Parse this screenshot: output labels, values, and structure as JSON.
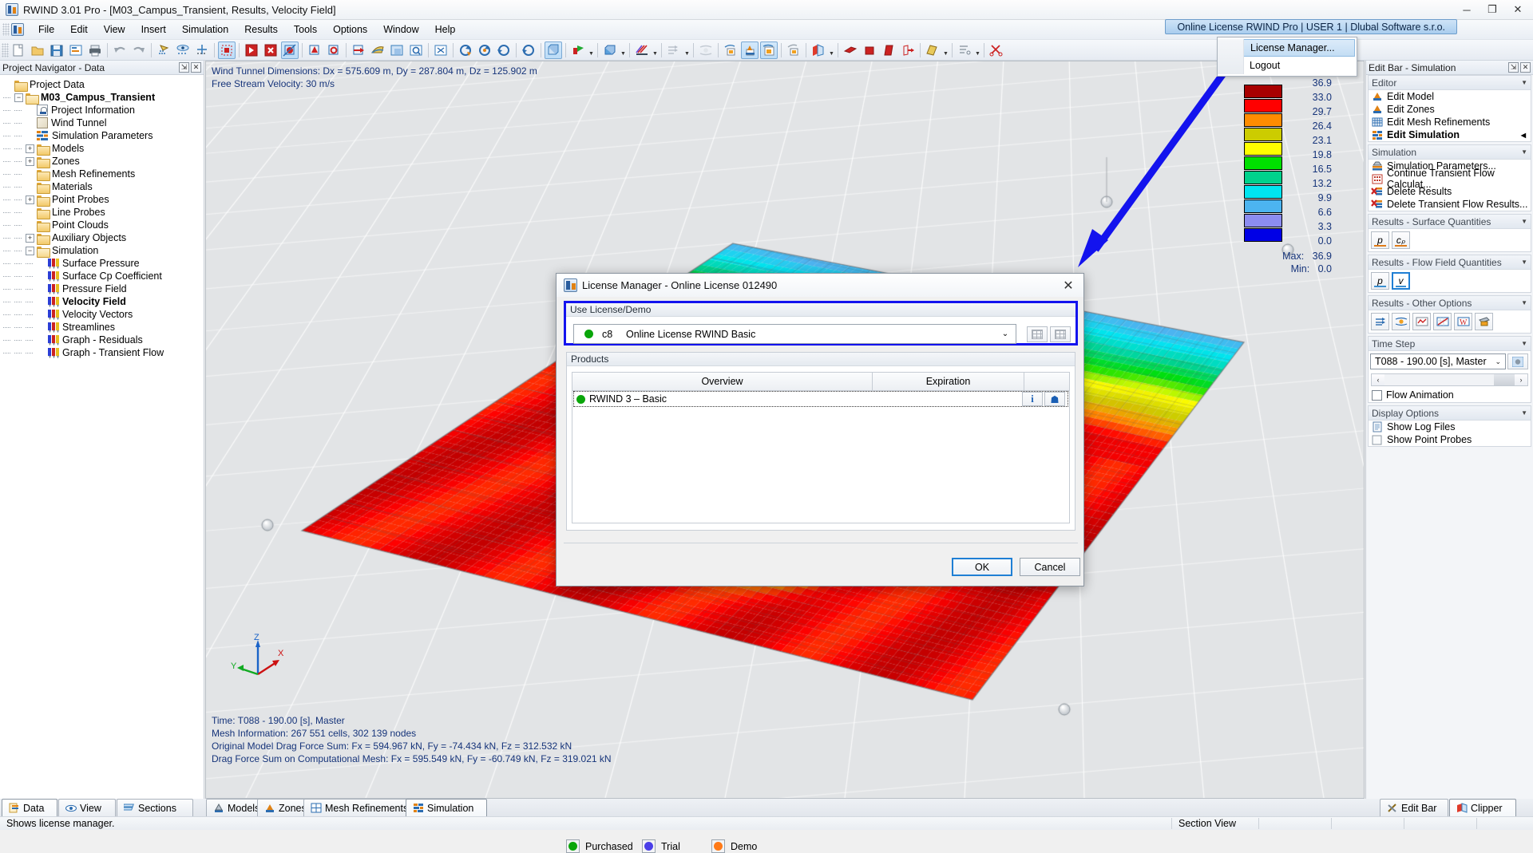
{
  "titlebar": {
    "title": "RWIND 3.01 Pro - [M03_Campus_Transient, Results, Velocity Field]",
    "minimize": "─",
    "restore": "❐",
    "close": "✕"
  },
  "menubar": {
    "items": [
      "File",
      "Edit",
      "View",
      "Insert",
      "Simulation",
      "Results",
      "Tools",
      "Options",
      "Window",
      "Help"
    ]
  },
  "license": {
    "button_label": "Online License RWIND Pro | USER 1 | Dlubal Software s.r.o.",
    "menu": [
      "License Manager...",
      "Logout"
    ]
  },
  "navigator": {
    "title": "Project Navigator - Data",
    "pin": "⇲",
    "close": "✕",
    "tree": [
      {
        "label": "Project Data",
        "depth": 0,
        "icon": "folder",
        "toggle": "none",
        "bold": false
      },
      {
        "label": "M03_Campus_Transient",
        "depth": 1,
        "icon": "folder-open",
        "toggle": "minus",
        "bold": true
      },
      {
        "label": "Project Information",
        "depth": 2,
        "icon": "doc",
        "toggle": "none",
        "bold": false
      },
      {
        "label": "Wind Tunnel",
        "depth": 2,
        "icon": "cube",
        "toggle": "none",
        "bold": false
      },
      {
        "label": "Simulation Parameters",
        "depth": 2,
        "icon": "simparams",
        "toggle": "none",
        "bold": false
      },
      {
        "label": "Models",
        "depth": 2,
        "icon": "folder",
        "toggle": "plus",
        "bold": false
      },
      {
        "label": "Zones",
        "depth": 2,
        "icon": "folder",
        "toggle": "plus",
        "bold": false
      },
      {
        "label": "Mesh Refinements",
        "depth": 2,
        "icon": "folder",
        "toggle": "none",
        "bold": false
      },
      {
        "label": "Materials",
        "depth": 2,
        "icon": "folder",
        "toggle": "none",
        "bold": false
      },
      {
        "label": "Point Probes",
        "depth": 2,
        "icon": "folder",
        "toggle": "plus",
        "bold": false
      },
      {
        "label": "Line Probes",
        "depth": 2,
        "icon": "folder",
        "toggle": "none",
        "bold": false
      },
      {
        "label": "Point Clouds",
        "depth": 2,
        "icon": "folder",
        "toggle": "none",
        "bold": false
      },
      {
        "label": "Auxiliary Objects",
        "depth": 2,
        "icon": "folder",
        "toggle": "plus",
        "bold": false
      },
      {
        "label": "Simulation",
        "depth": 2,
        "icon": "folder-open",
        "toggle": "minus",
        "bold": false
      },
      {
        "label": "Surface Pressure",
        "depth": 3,
        "icon": "bars",
        "toggle": "none",
        "bold": false
      },
      {
        "label": "Surface Cp Coefficient",
        "depth": 3,
        "icon": "bars",
        "toggle": "none",
        "bold": false
      },
      {
        "label": "Pressure Field",
        "depth": 3,
        "icon": "bars",
        "toggle": "none",
        "bold": false
      },
      {
        "label": "Velocity Field",
        "depth": 3,
        "icon": "bars",
        "toggle": "none",
        "bold": true
      },
      {
        "label": "Velocity Vectors",
        "depth": 3,
        "icon": "bars",
        "toggle": "none",
        "bold": false
      },
      {
        "label": "Streamlines",
        "depth": 3,
        "icon": "bars",
        "toggle": "none",
        "bold": false
      },
      {
        "label": "Graph - Residuals",
        "depth": 3,
        "icon": "bars",
        "toggle": "none",
        "bold": false
      },
      {
        "label": "Graph - Transient Flow",
        "depth": 3,
        "icon": "bars",
        "toggle": "none",
        "bold": false
      }
    ]
  },
  "view3d": {
    "top_info_line1": "Wind Tunnel Dimensions: Dx = 575.609 m, Dy = 287.804 m, Dz = 125.902 m",
    "top_info_line2": "Free Stream Velocity: 30 m/s",
    "bottom_info": [
      "Time: T088 - 190.00 [s], Master",
      "Mesh Information: 267 551 cells, 302 139 nodes",
      "Original Model Drag Force Sum: Fx = 594.967 kN, Fy = -74.434 kN, Fz = 312.532 kN",
      "Drag Force Sum on Computational Mesh: Fx = 595.549 kN, Fy = -60.749 kN, Fz = 319.021 kN"
    ],
    "axes": {
      "x": "X",
      "y": "Y",
      "z": "Z"
    }
  },
  "legend": {
    "colors": [
      "#a80000",
      "#ff0000",
      "#ff8c00",
      "#cccc00",
      "#ffff00",
      "#00e000",
      "#00d28c",
      "#00e5f0",
      "#4cb4f0",
      "#8c8cf0",
      "#0000e6"
    ],
    "ticks": [
      "36.9",
      "33.0",
      "29.7",
      "26.4",
      "23.1",
      "19.8",
      "16.5",
      "13.2",
      "9.9",
      "6.6",
      "3.3",
      "0.0"
    ],
    "max_label": "Max:",
    "max_value": "36.9",
    "min_label": "Min:",
    "min_value": "0.0"
  },
  "editbar": {
    "title": "Edit Bar - Simulation",
    "pin": "⇲",
    "close": "✕",
    "sections": [
      {
        "title": "Editor",
        "items": [
          {
            "label": "Edit Model",
            "icon": "model-icon",
            "bold": false,
            "marker": ""
          },
          {
            "label": "Edit Zones",
            "icon": "zones-icon",
            "bold": false,
            "marker": ""
          },
          {
            "label": "Edit Mesh Refinements",
            "icon": "mesh-icon",
            "bold": false,
            "marker": ""
          },
          {
            "label": "Edit Simulation",
            "icon": "simulation-icon",
            "bold": true,
            "marker": "◀"
          }
        ]
      },
      {
        "title": "Simulation",
        "items": [
          {
            "label": "Simulation Parameters...",
            "icon": "params-icon",
            "bold": false,
            "marker": ""
          },
          {
            "label": "Continue Transient Flow Calculat...",
            "icon": "continue-icon",
            "bold": false,
            "marker": ""
          },
          {
            "label": "Delete Results",
            "icon": "delete-results-icon",
            "bold": false,
            "marker": ""
          },
          {
            "label": "Delete Transient Flow Results...",
            "icon": "delete-transient-icon",
            "bold": false,
            "marker": ""
          }
        ]
      }
    ],
    "surface_quantities": {
      "title": "Results - Surface Quantities",
      "buttons": [
        "p",
        "cₚ"
      ]
    },
    "flow_quantities": {
      "title": "Results - Flow Field Quantities",
      "buttons": [
        "p",
        "v"
      ],
      "selected_index": 1
    },
    "other_options": {
      "title": "Results - Other Options",
      "buttons": [
        "vectors-icon",
        "streamlines-icon",
        "graph-icon",
        "chart-icon",
        "wind-icon",
        "render-icon"
      ]
    },
    "time_step": {
      "title": "Time Step",
      "value": "T088 - 190.00 [s], Master",
      "dropdown_arrow": "⌄",
      "prev": "‹",
      "next": "›",
      "flow_animation": "Flow Animation",
      "flow_animation_checked": false
    },
    "display_options": {
      "title": "Display Options",
      "items": [
        {
          "label": "Show Log Files",
          "icon": "log-file-icon"
        },
        {
          "label": "Show Point Probes",
          "icon": "point-probe-icon"
        }
      ]
    }
  },
  "dialog": {
    "title": "License Manager - Online License 012490",
    "close": "✕",
    "use_license_caption": "Use License/Demo",
    "selected_license": {
      "code": "c8",
      "name": "Online License RWIND Basic",
      "status_color": "#0aa60a"
    },
    "products_caption": "Products",
    "table": {
      "headers": [
        "Overview",
        "Expiration",
        ""
      ],
      "rows": [
        {
          "name": "RWIND 3 – Basic",
          "expiration": "",
          "status_color": "#0aa60a",
          "info": "i",
          "cart": "☗"
        }
      ]
    },
    "legend": [
      {
        "label": "Purchased",
        "color": "#0aa60a"
      },
      {
        "label": "Trial",
        "color": "#4a3ee8"
      },
      {
        "label": "Demo",
        "color": "#ff7a18"
      }
    ],
    "buttons": {
      "ok": "OK",
      "cancel": "Cancel"
    }
  },
  "bottom_tabs": {
    "left": [
      {
        "label": "Data",
        "active": true
      },
      {
        "label": "View",
        "active": false
      },
      {
        "label": "Sections",
        "active": false
      }
    ],
    "center": [
      {
        "label": "Models",
        "active": false
      },
      {
        "label": "Zones",
        "active": false
      },
      {
        "label": "Mesh Refinements",
        "active": false
      },
      {
        "label": "Simulation",
        "active": true
      }
    ],
    "right": [
      {
        "label": "Edit Bar",
        "active": false
      },
      {
        "label": "Clipper",
        "active": true
      }
    ]
  },
  "statusbar": {
    "message": "Shows license manager.",
    "section_view": "Section View"
  }
}
